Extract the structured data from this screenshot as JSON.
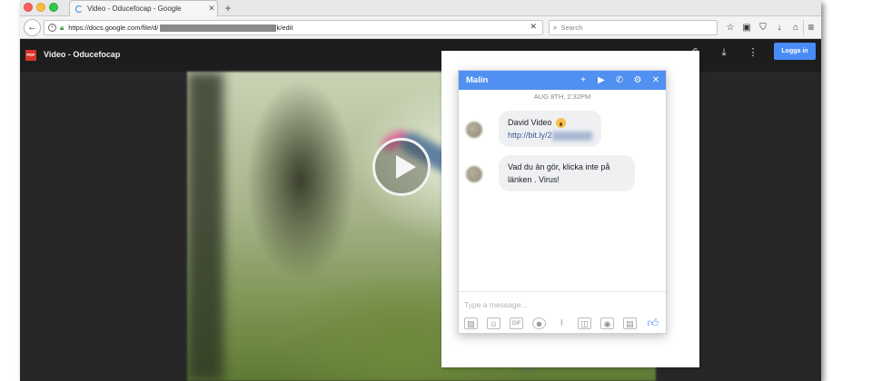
{
  "browser": {
    "tab_title": "Video - Oducefocap - Google",
    "tab_close": "✕",
    "newtab_label": "+",
    "back_icon": "←",
    "url_prefix": "https://docs.google.com/file/d/",
    "url_suffix": "k/edit",
    "url_clear": "✕",
    "search_placeholder": "Search",
    "nav_icons": [
      "star-icon",
      "clipboard-icon",
      "pocket-icon",
      "download-icon",
      "home-icon"
    ],
    "menu_icon": "hamburger-menu-icon"
  },
  "viewer": {
    "pdf_badge": "PDF",
    "doc_title": "Video - Oducefocap",
    "login_label": "Logga in"
  },
  "messenger": {
    "contact_name": "Malin",
    "timestamp": "AUG 8TH, 2:32PM",
    "messages": [
      {
        "line1": "David Video",
        "link_text": "http://bit.ly/2"
      },
      {
        "text": "Vad du än gör, klicka inte på länken . Virus!"
      }
    ],
    "compose_placeholder": "Type a message..."
  },
  "colors": {
    "messenger_blue": "#4f90f0",
    "login_blue": "#4a8cf5",
    "pdf_red": "#d9342b"
  }
}
